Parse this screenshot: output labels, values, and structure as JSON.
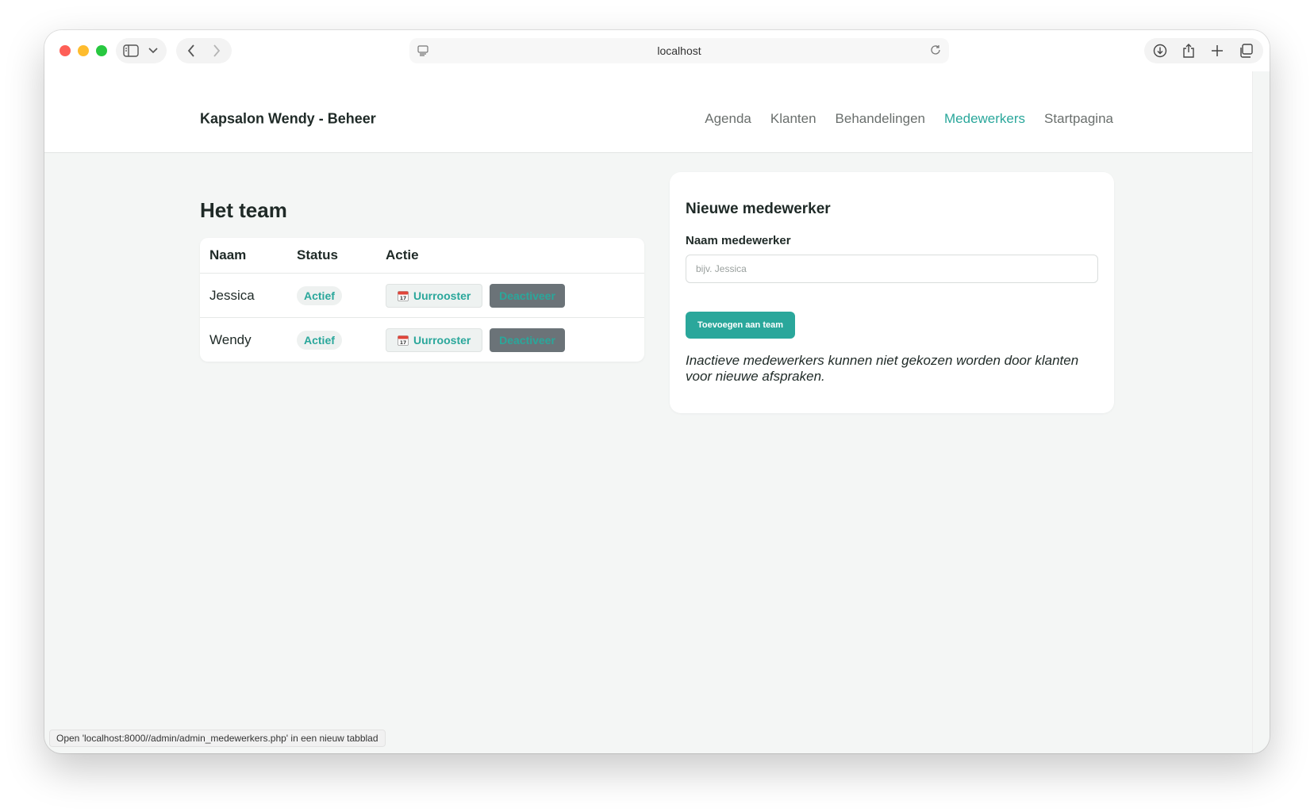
{
  "browser": {
    "url": "localhost",
    "status_text": "Open 'localhost:8000//admin/admin_medewerkers.php' in een nieuw tabblad"
  },
  "nav": {
    "brand": "Kapsalon Wendy - Beheer",
    "links": [
      {
        "label": "Agenda",
        "active": false
      },
      {
        "label": "Klanten",
        "active": false
      },
      {
        "label": "Behandelingen",
        "active": false
      },
      {
        "label": "Medewerkers",
        "active": true
      },
      {
        "label": "Startpagina",
        "active": false
      }
    ]
  },
  "team": {
    "title": "Het team",
    "columns": [
      "Naam",
      "Status",
      "Actie"
    ],
    "rows": [
      {
        "name": "Jessica",
        "status": "Actief",
        "schedule_label": "Uurrooster",
        "deactivate_label": "Deactiveer"
      },
      {
        "name": "Wendy",
        "status": "Actief",
        "schedule_label": "Uurrooster",
        "deactivate_label": "Deactiveer"
      }
    ]
  },
  "form": {
    "title": "Nieuwe medewerker",
    "label": "Naam medewerker",
    "placeholder": "bijv. Jessica",
    "submit_label": "Toevoegen aan team",
    "note": "Inactieve medewerkers kunnen niet gekozen worden door klanten voor nieuwe afspraken."
  },
  "colors": {
    "accent": "#2aa79b",
    "deactivate_bg": "#6b7378"
  }
}
